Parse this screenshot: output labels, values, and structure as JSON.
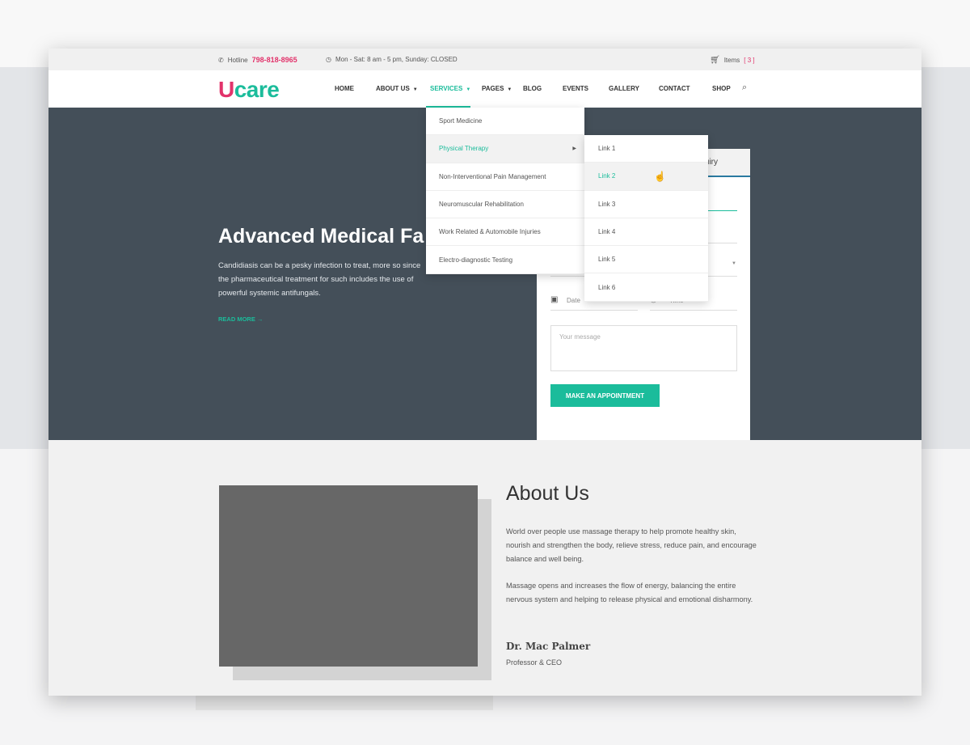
{
  "topbar": {
    "hotline_label": "Hotline",
    "hotline_number": "798-818-8965",
    "hours": "Mon - Sat: 8 am - 5 pm, Sunday: CLOSED",
    "cart_label": "Items",
    "cart_count": "[ 3 ]"
  },
  "logo": {
    "u": "U",
    "rest": "care"
  },
  "nav": {
    "items": [
      "HOME",
      "ABOUT US",
      "SERVICES",
      "PAGES",
      "BLOG",
      "EVENTS",
      "GALLERY",
      "CONTACT",
      "SHOP"
    ],
    "active": "SERVICES"
  },
  "services_menu": [
    "Sport Medicine",
    "Physical Therapy",
    "Non-Interventional Pain Management",
    "Neuromuscular Rehabilitation",
    "Work Related & Automobile Injuries",
    "Electro-diagnostic Testing"
  ],
  "submenu": [
    "Link 1",
    "Link 2",
    "Link 3",
    "Link 4",
    "Link 5",
    "Link 6"
  ],
  "hero": {
    "title": "Advanced Medical Fa",
    "text": "Candidiasis can be a pesky infection to treat, more so since the pharmaceutical treatment for such includes the use of powerful systemic antifungals.",
    "read_more": "READ MORE →"
  },
  "form": {
    "tab": "Enquiry",
    "date_placeholder": "Date",
    "time_placeholder": "Time",
    "message_placeholder": "Your message",
    "submit": "MAKE AN APPOINTMENT"
  },
  "about": {
    "title": "About Us",
    "p1": "World over people use massage therapy to help promote healthy skin, nourish and strengthen the body, relieve stress, reduce pain, and encourage balance and well being.",
    "p2": "Massage opens and increases the flow of energy, balancing the entire nervous system and helping to release physical and emotional disharmony.",
    "name": "Dr. Mac Palmer",
    "role": "Professor & CEO"
  },
  "colors": {
    "accent": "#1bbc9b",
    "brand_pink": "#e2336b",
    "hero_bg": "#444f59"
  }
}
